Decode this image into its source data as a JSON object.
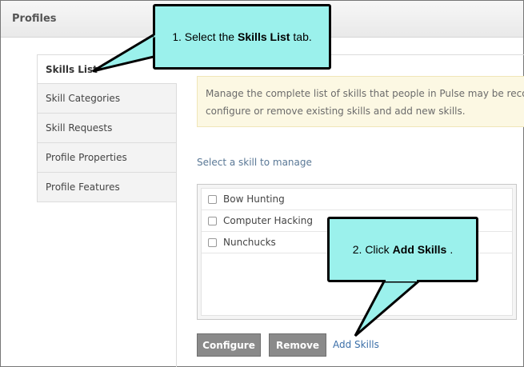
{
  "header": {
    "title": "Profiles"
  },
  "tabs": [
    {
      "label": "Skills List",
      "active": true
    },
    {
      "label": "Skill Categories"
    },
    {
      "label": "Skill Requests"
    },
    {
      "label": "Profile Properties"
    },
    {
      "label": "Profile Features"
    }
  ],
  "info": {
    "line1": "Manage the complete list of skills that people in Pulse may be recogn",
    "line2": "configure or remove existing skills and add new skills."
  },
  "select_label": "Select a skill to manage",
  "skills": [
    {
      "label": "Bow Hunting",
      "checked": false
    },
    {
      "label": "Computer Hacking",
      "checked": false
    },
    {
      "label": "Nunchucks",
      "checked": false
    }
  ],
  "buttons": {
    "configure": "Configure",
    "remove": "Remove",
    "add": "Add Skills"
  },
  "callouts": {
    "one": {
      "prefix": "1. Select the",
      "bold": "Skills List",
      "suffix": "tab."
    },
    "two": {
      "prefix": "2. Click",
      "bold": "Add Skills",
      "suffix": "."
    }
  },
  "colors": {
    "callout_fill": "#9bf1ec",
    "button_bg": "#8a8a8a",
    "link": "#3b6fa8",
    "info_bg": "#fcf8e3"
  }
}
